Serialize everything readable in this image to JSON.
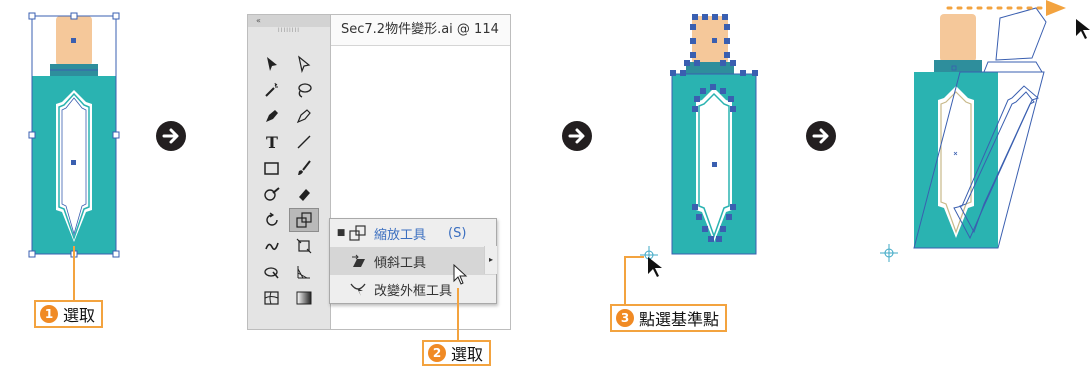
{
  "steps": {
    "step1": {
      "number": "1",
      "label": "選取"
    },
    "step2": {
      "number": "2",
      "label": "選取"
    },
    "step3": {
      "number": "3",
      "label": "點選基準點"
    }
  },
  "toolbox": {
    "collapse_glyph": "«",
    "grip_glyph": "IIIIIIII"
  },
  "document": {
    "tab_title": "Sec7.2物件變形.ai @ 114"
  },
  "flyout": {
    "items": [
      {
        "label": "縮放工具",
        "shortcut": "(S)",
        "selected": true,
        "icon": "scale-icon"
      },
      {
        "label": "傾斜工具",
        "shortcut": "",
        "selected": false,
        "icon": "shear-icon"
      },
      {
        "label": "改變外框工具",
        "shortcut": "",
        "selected": false,
        "icon": "reshape-icon"
      }
    ]
  },
  "colors": {
    "teal": "#2ab3b1",
    "cap": "#f5c89a",
    "selection_blue": "#3a5fb0",
    "callout_orange": "#f3a33f",
    "link_blue": "#3b6fc0"
  }
}
